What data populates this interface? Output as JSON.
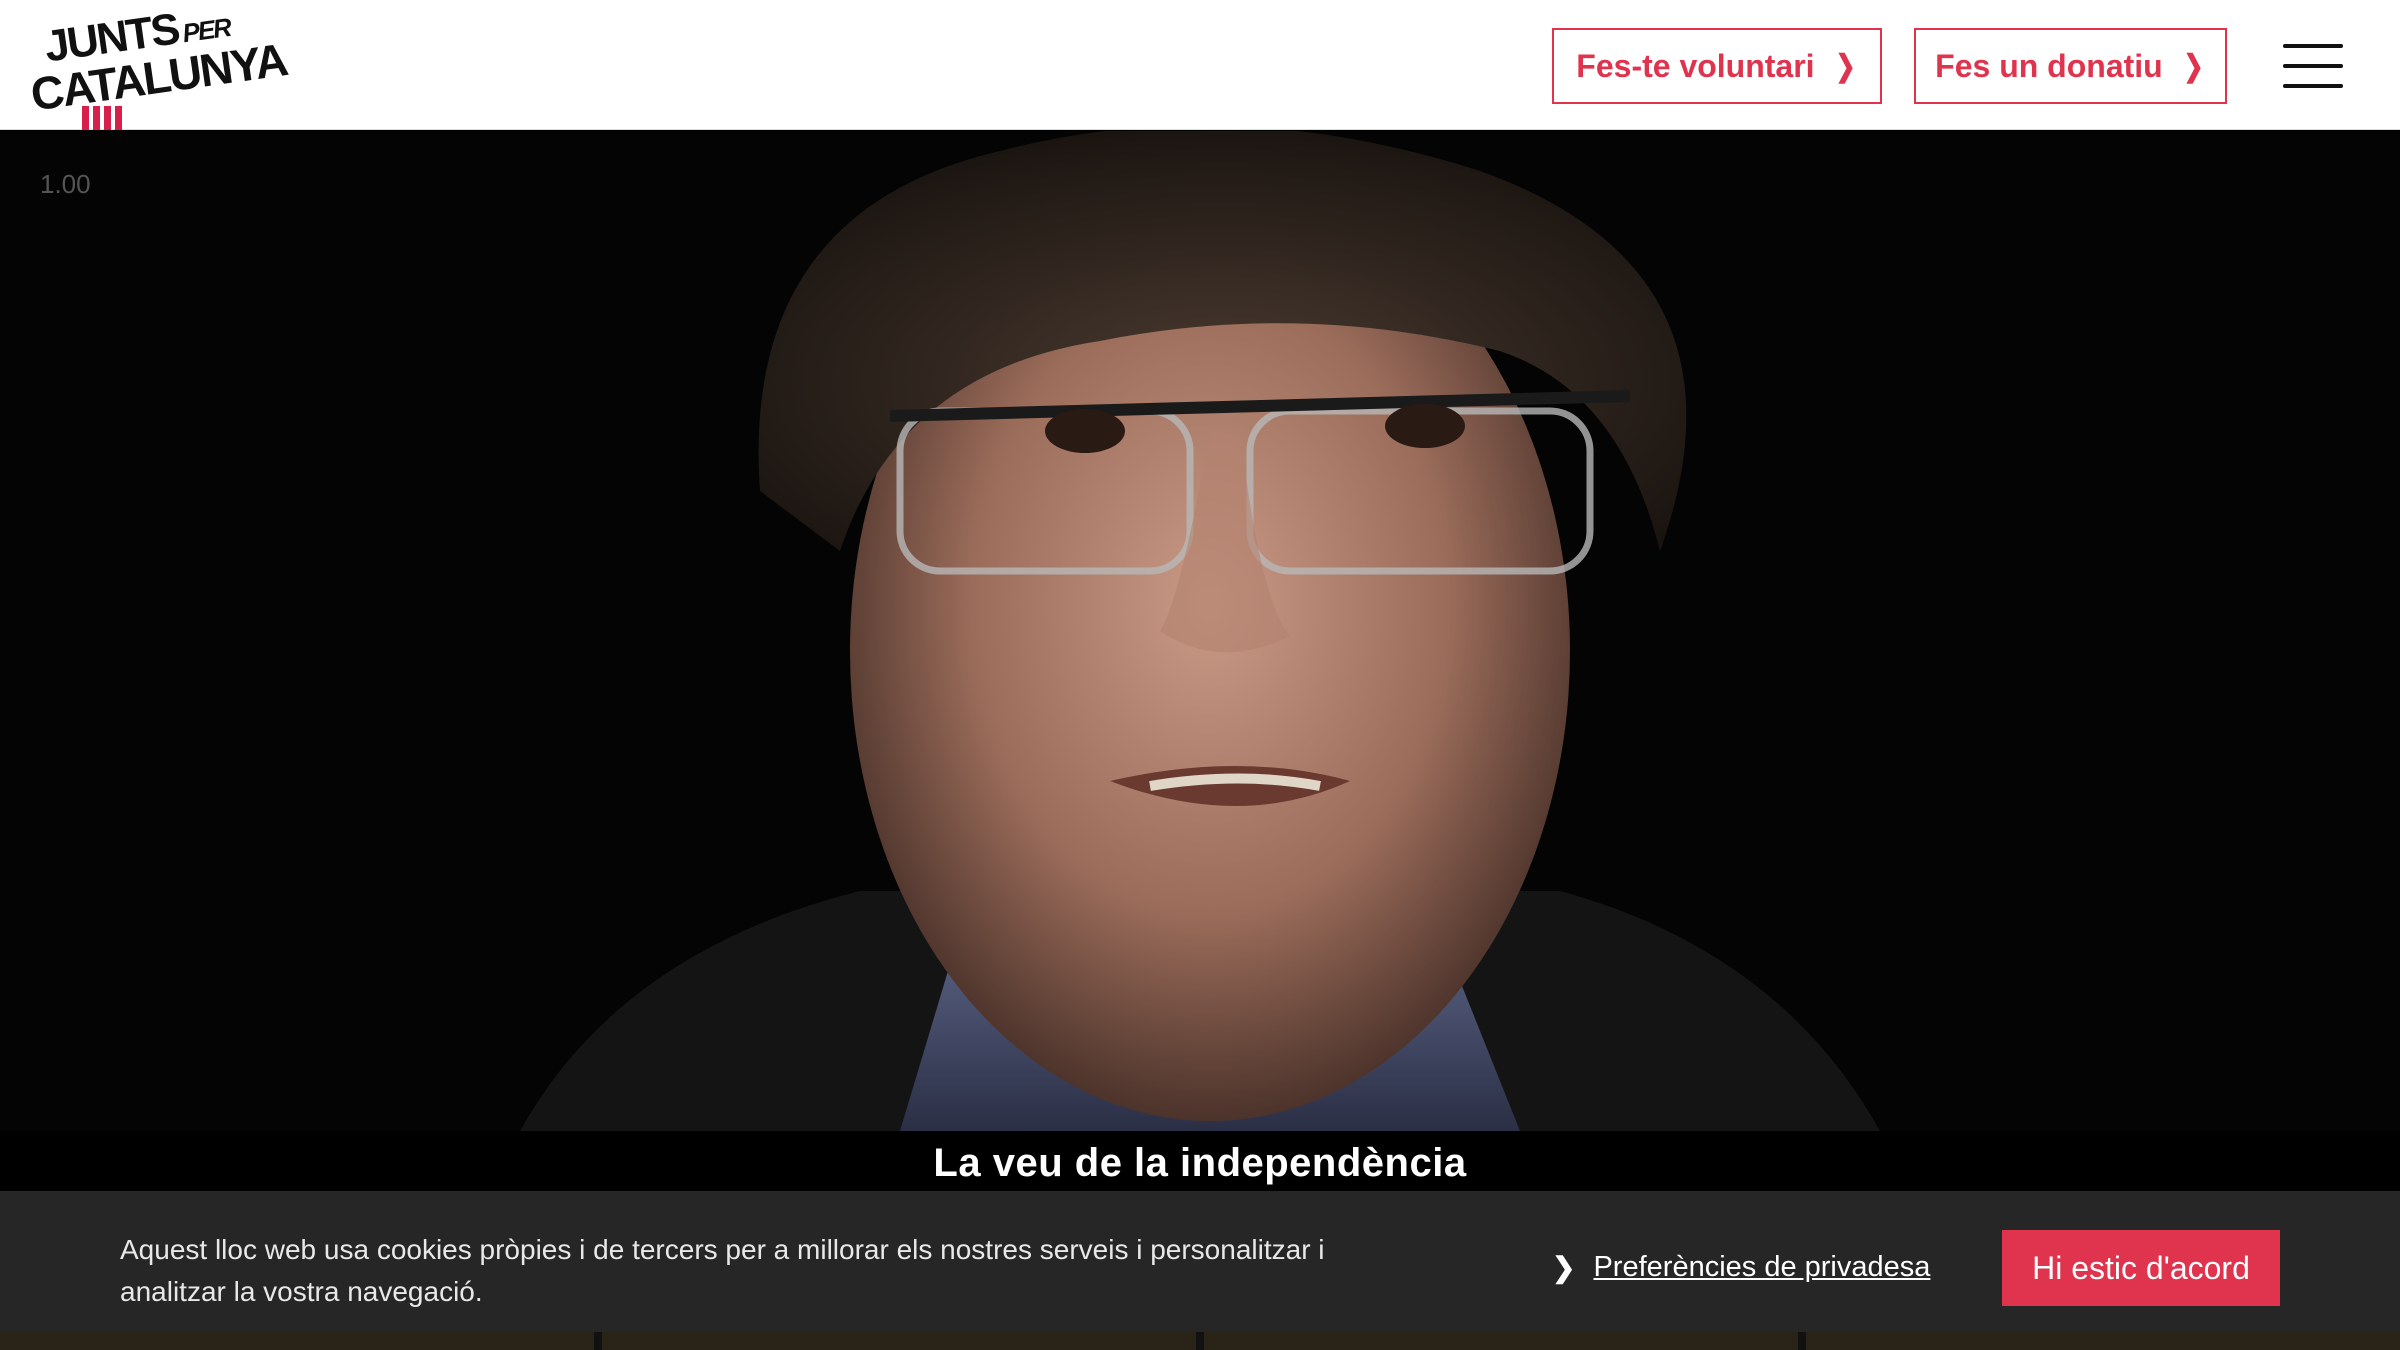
{
  "header": {
    "logo_line1": "JUNTS",
    "logo_per": "PER",
    "logo_line2": "CATALUNYA",
    "volunteer_label": "Fes-te voluntari",
    "donate_label": "Fes un donatiu",
    "brand_color": "#e0334e",
    "menu_icon": "hamburger-icon"
  },
  "video": {
    "playback_speed": "1.00",
    "subtitle": "La veu de la independència"
  },
  "cookie_banner": {
    "text": "Aquest lloc web usa cookies pròpies i de tercers per a millorar els nostres serveis i personalitzar i analitzar la vostra navegació.",
    "preferences_label": "Preferències de privadesa",
    "accept_label": "Hi estic d'acord"
  }
}
